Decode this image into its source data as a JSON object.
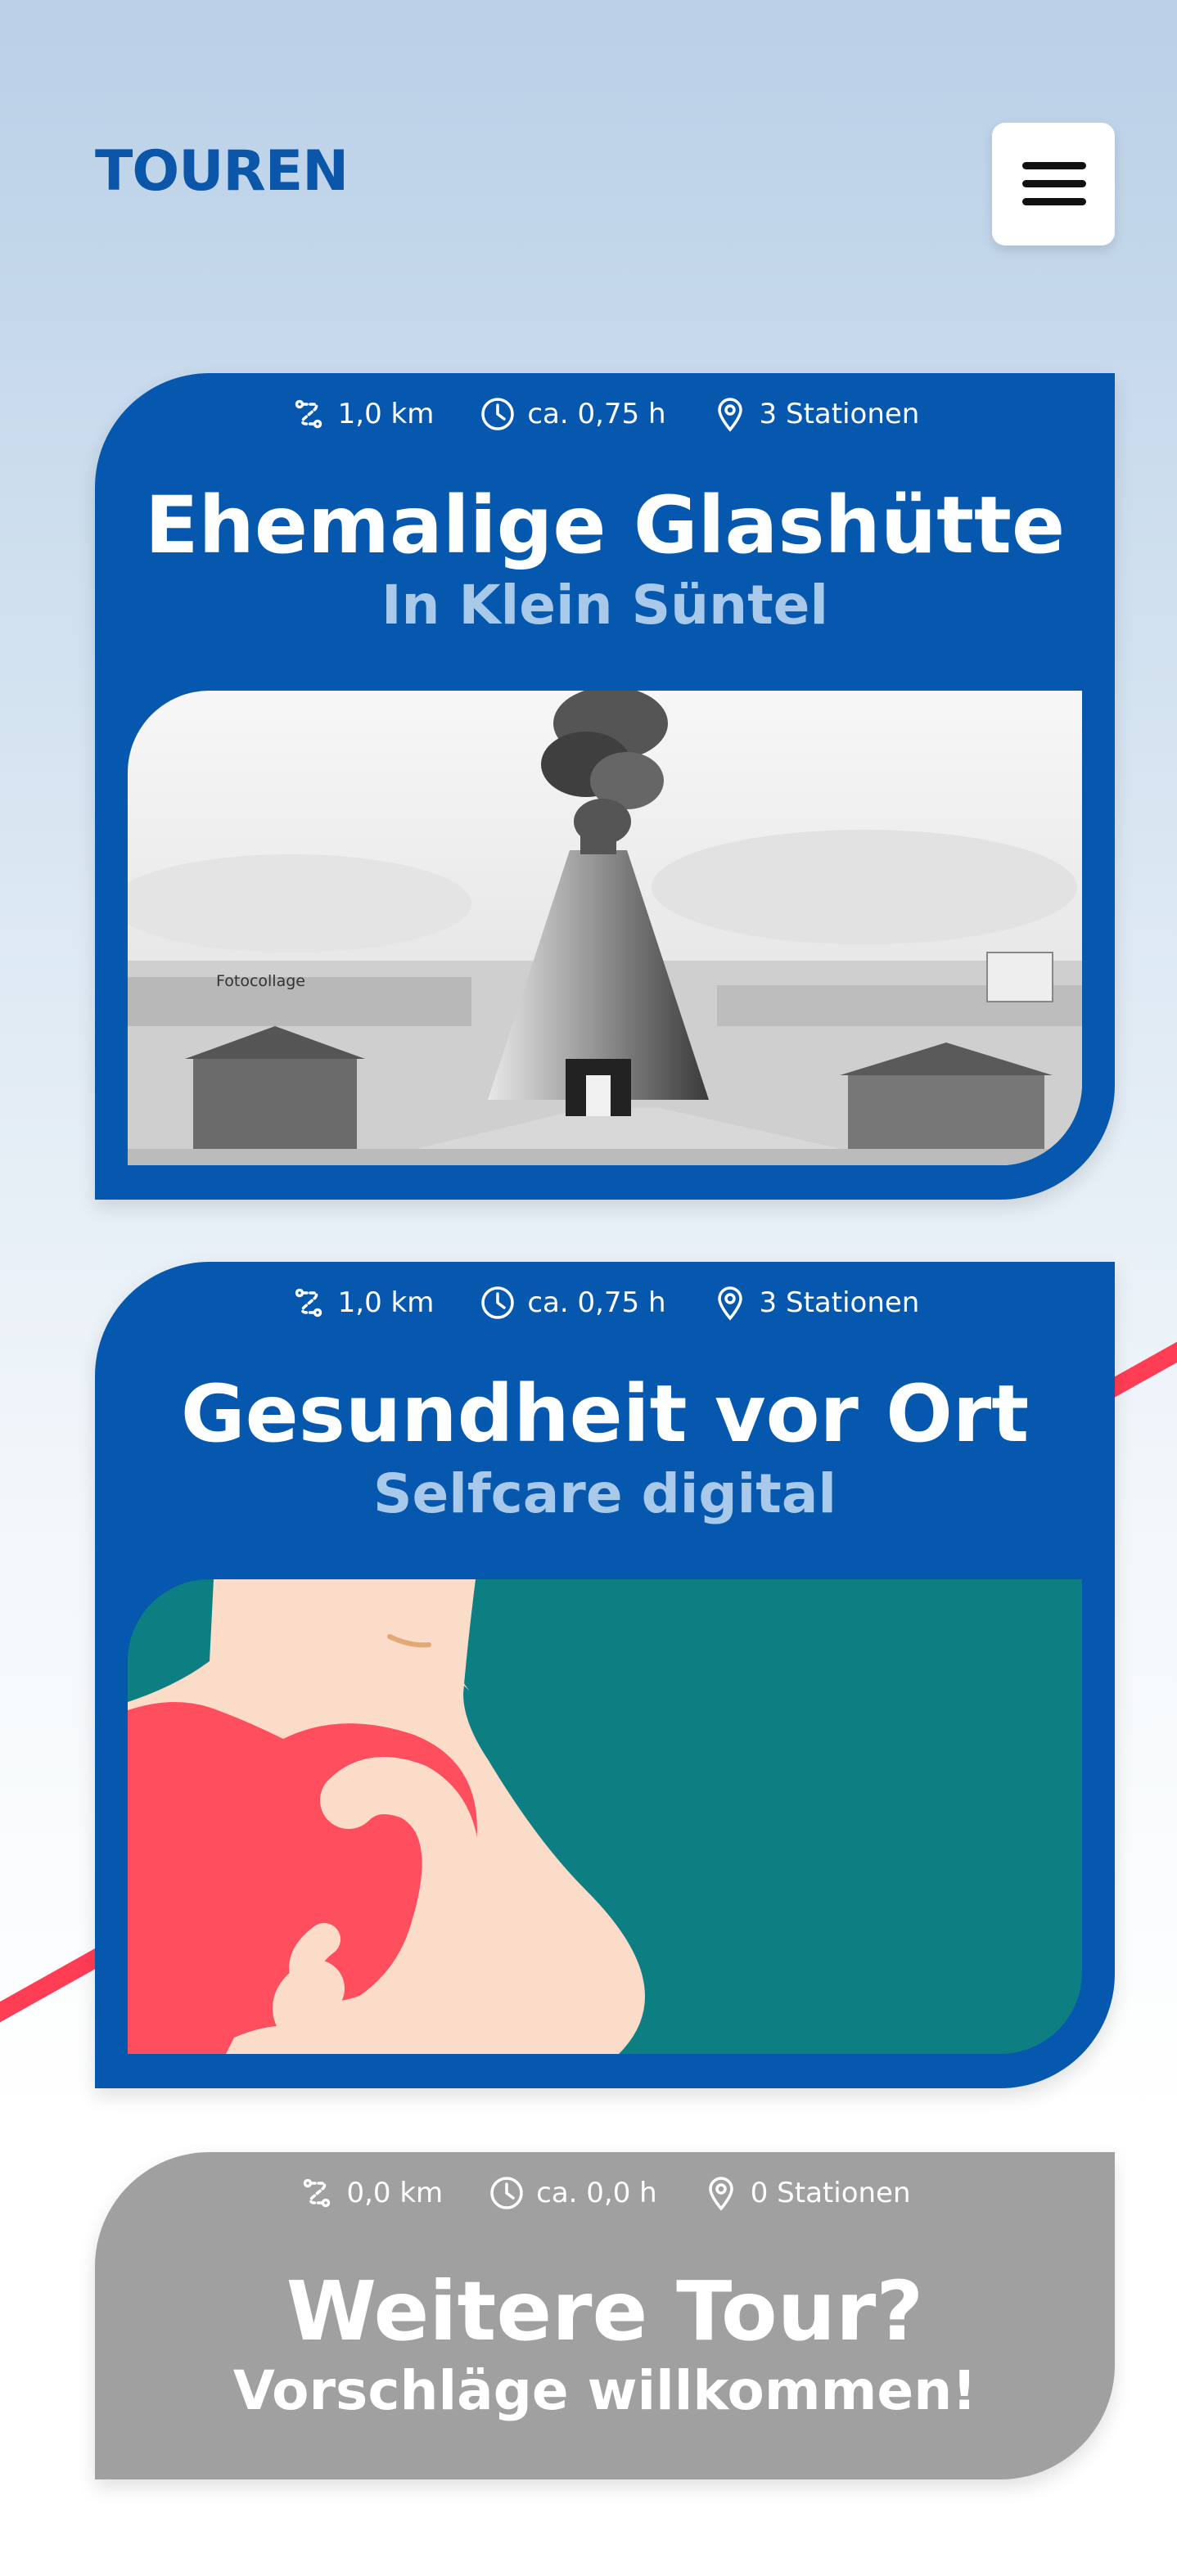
{
  "header": {
    "title": "TOUREN",
    "menu_icon": "hamburger-menu-icon"
  },
  "colors": {
    "brand_blue": "#0558ad",
    "subtitle_blue": "#a9c9ea",
    "card_grey": "#a0a0a0",
    "accent_red": "#ff3d55",
    "teal": "#0d7f82"
  },
  "tours": [
    {
      "distance": "1,0 km",
      "duration": "ca. 0,75 h",
      "stations": "3 Stationen",
      "title": "Ehemalige Glashütte",
      "subtitle": "In Klein Süntel",
      "image_caption": "Fotocollage"
    },
    {
      "distance": "1,0 km",
      "duration": "ca. 0,75 h",
      "stations": "3 Stationen",
      "title": "Gesundheit vor Ort",
      "subtitle": "Selfcare digital"
    },
    {
      "distance": "0,0 km",
      "duration": "ca. 0,0 h",
      "stations": "0 Stationen",
      "title": "Weitere Tour?",
      "subtitle": "Vorschläge willkommen!"
    }
  ],
  "icons": {
    "distance": "route-icon",
    "duration": "clock-icon",
    "stations": "location-pin-icon"
  }
}
